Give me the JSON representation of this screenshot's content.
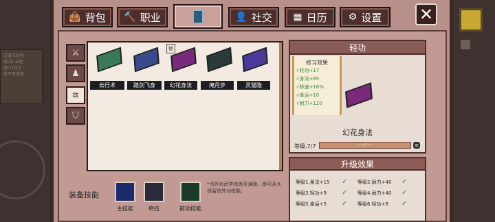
{
  "tabs": [
    {
      "icon": "bag-icon",
      "label": "背包"
    },
    {
      "icon": "hammer-icon",
      "label": "职业"
    },
    {
      "icon": "book-icon",
      "label": ""
    },
    {
      "icon": "people-icon",
      "label": "社交"
    },
    {
      "icon": "calendar-icon",
      "label": "日历"
    },
    {
      "icon": "gear-icon",
      "label": "设置"
    }
  ],
  "categories": [
    "swords-icon",
    "meditate-icon",
    "wind-icon",
    "shield-icon"
  ],
  "skills": [
    {
      "name": "云行术",
      "color": "#3a7a5a"
    },
    {
      "name": "踏剑飞身",
      "color": "#3a4a8a"
    },
    {
      "name": "幻花身法",
      "color": "#7a2a7a"
    },
    {
      "name": "掩月步",
      "color": "#2a3a3a"
    },
    {
      "name": "灵猫隐",
      "color": "#4a3a9a"
    }
  ],
  "selected_badge": "修",
  "equip": {
    "label": "装备技能",
    "slots": [
      {
        "label": "主技能",
        "icon": "blue-flame-icon"
      },
      {
        "label": "绝技",
        "icon": "crescent-icon"
      },
      {
        "label": "被动技能",
        "icon": "green-flame-icon"
      }
    ],
    "note": "*当外功武学修炼至满级，即可永久保留该外功技能。"
  },
  "detail": {
    "header": "轻功",
    "effects_title": "修习效果",
    "effects": [
      "√轻功+17",
      "√身法+85",
      "√移速+16%",
      "√幸运+10",
      "√耐力+120"
    ],
    "name": "幻花身法",
    "level_label": "等级.7/7",
    "level_progress": 1.0,
    "bar_text": "——/——"
  },
  "upgrade": {
    "header": "升级效果",
    "rows": [
      [
        "等级1.身法+15",
        "等级2.耐力+40"
      ],
      [
        "等级3.轻功+9",
        "等级4.耐力+40"
      ],
      [
        "等级5.幸运+5",
        "等级6.轻功+8"
      ]
    ]
  },
  "background": {
    "panel_lines": [
      "过渡衣秘色",
      "短(B)  云任",
      "房(1)羽上",
      "技开无夜容"
    ]
  }
}
